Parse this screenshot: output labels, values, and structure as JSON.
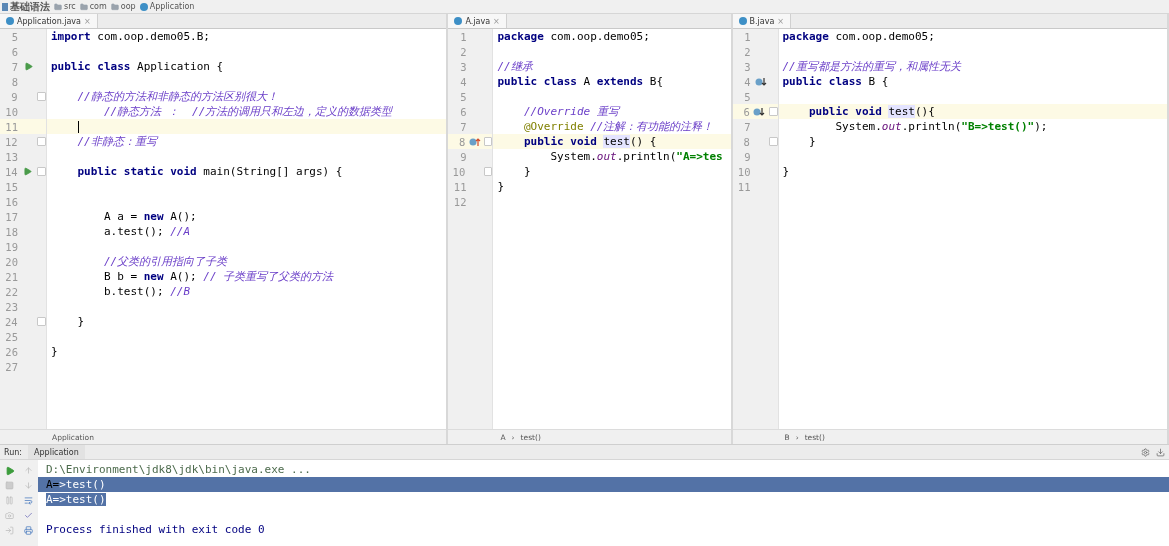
{
  "breadcrumb": [
    {
      "kind": "module",
      "label": "基础语法"
    },
    {
      "kind": "folder",
      "label": "src"
    },
    {
      "kind": "folder",
      "label": "com"
    },
    {
      "kind": "folder",
      "label": "oop"
    },
    {
      "kind": "class",
      "label": "Application"
    }
  ],
  "panes": [
    {
      "tab": {
        "label": "Application.java",
        "close": "×"
      },
      "footer": [
        "Application"
      ],
      "lines": [
        {
          "n": "5",
          "code": [
            {
              "kind": "kw",
              "text": "import"
            },
            {
              "kind": "plain",
              "text": " com.oop.demo05.B;"
            }
          ]
        },
        {
          "n": "6"
        },
        {
          "n": "7",
          "gutter_icon": {
            "kind": "run"
          },
          "code": [
            {
              "kind": "kw",
              "text": "public class"
            },
            {
              "kind": "plain",
              "text": " Application {"
            }
          ]
        },
        {
          "n": "8"
        },
        {
          "n": "9",
          "fold": true,
          "code": [
            {
              "kind": "comment",
              "text": "    //静态的方法和非静态的方法区别很大！"
            }
          ]
        },
        {
          "n": "10",
          "code": [
            {
              "kind": "comment",
              "text": "        //静态方法 ：  //方法的调用只和左边，定义的数据类型"
            }
          ]
        },
        {
          "n": "11",
          "current": true,
          "caret": true
        },
        {
          "n": "12",
          "fold": true,
          "code": [
            {
              "kind": "comment",
              "text": "    //非静态：重写"
            }
          ]
        },
        {
          "n": "13"
        },
        {
          "n": "14",
          "gutter_icon": {
            "kind": "run"
          },
          "fold": true,
          "code": [
            {
              "kind": "kw",
              "text": "    public static void"
            },
            {
              "kind": "plain",
              "text": " main(String[] args) {"
            }
          ]
        },
        {
          "n": "15"
        },
        {
          "n": "16"
        },
        {
          "n": "17",
          "code": [
            {
              "kind": "plain",
              "text": "        A a = "
            },
            {
              "kind": "kw",
              "text": "new"
            },
            {
              "kind": "plain",
              "text": " A();"
            }
          ]
        },
        {
          "n": "18",
          "code": [
            {
              "kind": "plain",
              "text": "        a.test(); "
            },
            {
              "kind": "comment",
              "text": "//A"
            }
          ]
        },
        {
          "n": "19"
        },
        {
          "n": "20",
          "code": [
            {
              "kind": "comment",
              "text": "        //父类的引用指向了子类"
            }
          ]
        },
        {
          "n": "21",
          "code": [
            {
              "kind": "plain",
              "text": "        B b = "
            },
            {
              "kind": "kw",
              "text": "new"
            },
            {
              "kind": "plain",
              "text": " A(); "
            },
            {
              "kind": "comment",
              "text": "// 子类重写了父类的方法"
            }
          ]
        },
        {
          "n": "22",
          "code": [
            {
              "kind": "plain",
              "text": "        b.test(); "
            },
            {
              "kind": "comment",
              "text": "//B"
            }
          ]
        },
        {
          "n": "23"
        },
        {
          "n": "24",
          "fold": true,
          "code": [
            {
              "kind": "plain",
              "text": "    }"
            }
          ]
        },
        {
          "n": "25"
        },
        {
          "n": "26",
          "code": [
            {
              "kind": "plain",
              "text": "}"
            }
          ]
        },
        {
          "n": "27"
        }
      ]
    },
    {
      "tab": {
        "label": "A.java",
        "close": "×"
      },
      "footer": [
        "A",
        "›",
        "test()"
      ],
      "lines": [
        {
          "n": "1",
          "code": [
            {
              "kind": "kw",
              "text": "package"
            },
            {
              "kind": "plain",
              "text": " com.oop.demo05;"
            }
          ]
        },
        {
          "n": "2"
        },
        {
          "n": "3",
          "code": [
            {
              "kind": "comment",
              "text": "//继承"
            }
          ]
        },
        {
          "n": "4",
          "code": [
            {
              "kind": "kw",
              "text": "public class"
            },
            {
              "kind": "plain",
              "text": " A "
            },
            {
              "kind": "kw",
              "text": "extends"
            },
            {
              "kind": "plain",
              "text": " B{"
            }
          ]
        },
        {
          "n": "5"
        },
        {
          "n": "6",
          "code": [
            {
              "kind": "comment",
              "text": "    //Override 重写"
            }
          ]
        },
        {
          "n": "7",
          "code": [
            {
              "kind": "annotation",
              "text": "    @Override"
            },
            {
              "kind": "comment",
              "text": " //注解：有功能的注释！"
            }
          ]
        },
        {
          "n": "8",
          "current": true,
          "gutter_icon": {
            "kind": "overrides"
          },
          "fold": true,
          "code": [
            {
              "kind": "kw",
              "text": "    public void "
            },
            {
              "kind": "usage",
              "text": "test"
            },
            {
              "kind": "plain",
              "text": "() {"
            }
          ]
        },
        {
          "n": "9",
          "code": [
            {
              "kind": "plain",
              "text": "        System."
            },
            {
              "kind": "field",
              "text": "out"
            },
            {
              "kind": "plain",
              "text": ".println("
            },
            {
              "kind": "string",
              "text": "\"A=>tes"
            }
          ]
        },
        {
          "n": "10",
          "fold": true,
          "code": [
            {
              "kind": "plain",
              "text": "    }"
            }
          ]
        },
        {
          "n": "11",
          "code": [
            {
              "kind": "plain",
              "text": "}"
            }
          ]
        },
        {
          "n": "12"
        }
      ]
    },
    {
      "tab": {
        "label": "B.java",
        "close": "×"
      },
      "footer": [
        "B",
        "›",
        "test()"
      ],
      "lines": [
        {
          "n": "1",
          "code": [
            {
              "kind": "kw",
              "text": "package"
            },
            {
              "kind": "plain",
              "text": " com.oop.demo05;"
            }
          ]
        },
        {
          "n": "2"
        },
        {
          "n": "3",
          "code": [
            {
              "kind": "comment",
              "text": "//重写都是方法的重写，和属性无关"
            }
          ]
        },
        {
          "n": "4",
          "gutter_icon": {
            "kind": "overridden"
          },
          "code": [
            {
              "kind": "kw",
              "text": "public class"
            },
            {
              "kind": "plain",
              "text": " B {"
            }
          ]
        },
        {
          "n": "5"
        },
        {
          "n": "6",
          "current": true,
          "gutter_icon": {
            "kind": "overridden"
          },
          "fold": true,
          "code": [
            {
              "kind": "kw",
              "text": "    public void "
            },
            {
              "kind": "usage",
              "text": "test"
            },
            {
              "kind": "plain",
              "text": "(){"
            }
          ]
        },
        {
          "n": "7",
          "code": [
            {
              "kind": "plain",
              "text": "        System."
            },
            {
              "kind": "field",
              "text": "out"
            },
            {
              "kind": "plain",
              "text": ".println("
            },
            {
              "kind": "string",
              "text": "\"B=>test()\""
            },
            {
              "kind": "plain",
              "text": ");"
            }
          ]
        },
        {
          "n": "8",
          "fold": true,
          "code": [
            {
              "kind": "plain",
              "text": "    }"
            }
          ]
        },
        {
          "n": "9"
        },
        {
          "n": "10",
          "code": [
            {
              "kind": "plain",
              "text": "}"
            }
          ]
        },
        {
          "n": "11"
        }
      ]
    }
  ],
  "run": {
    "label": "Run:",
    "tab": "Application",
    "console": [
      {
        "kind": "command",
        "row_selected": false,
        "parts": [
          {
            "text": "D:\\Environment\\jdk8\\jdk\\bin\\java.exe ...",
            "selected": false
          }
        ]
      },
      {
        "kind": "output",
        "row_selected": true,
        "parts": [
          {
            "text": "A=",
            "selected": false
          },
          {
            "text": ">test()",
            "selected": true
          }
        ]
      },
      {
        "kind": "output",
        "row_selected": false,
        "parts": [
          {
            "text": "A=>test()",
            "selected": true
          }
        ]
      },
      {
        "kind": "blank",
        "row_selected": false
      },
      {
        "kind": "status",
        "row_selected": false,
        "parts": [
          {
            "text": "Process finished with exit code 0",
            "selected": false
          }
        ]
      }
    ]
  }
}
